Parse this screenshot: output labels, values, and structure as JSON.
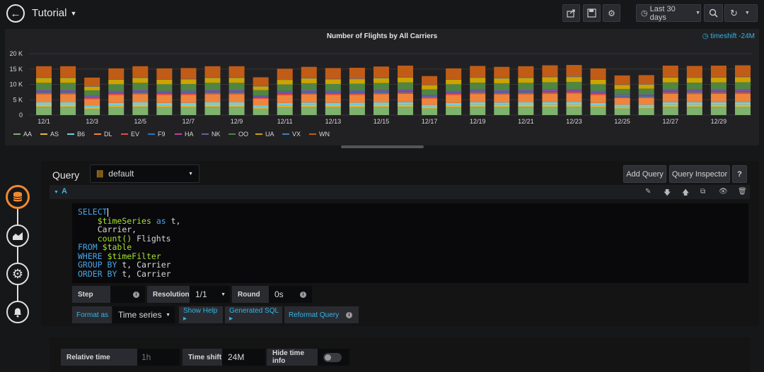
{
  "header": {
    "title": "Tutorial",
    "time_range": "Last 30 days",
    "icons": [
      "back-arrow-icon",
      "share-icon",
      "save-icon",
      "gear-icon",
      "clock-icon",
      "zoom-out-icon",
      "refresh-icon"
    ]
  },
  "panel": {
    "title": "Number of Flights by All Carriers",
    "timeshift_label": "timeshift -24M"
  },
  "chart_data": {
    "type": "bar",
    "stacked": true,
    "y_ticks": [
      "20 K",
      "15 K",
      "10 K",
      "5 K",
      "0"
    ],
    "ylim": [
      0,
      20000
    ],
    "x_tick_labels": [
      "12/1",
      "12/3",
      "12/5",
      "12/7",
      "12/9",
      "12/11",
      "12/13",
      "12/15",
      "12/17",
      "12/19",
      "12/21",
      "12/23",
      "12/25",
      "12/27",
      "12/29"
    ],
    "categories": [
      "12/1",
      "12/2",
      "12/3",
      "12/4",
      "12/5",
      "12/6",
      "12/7",
      "12/8",
      "12/9",
      "12/10",
      "12/11",
      "12/12",
      "12/13",
      "12/14",
      "12/15",
      "12/16",
      "12/17",
      "12/18",
      "12/19",
      "12/20",
      "12/21",
      "12/22",
      "12/23",
      "12/24",
      "12/25",
      "12/26",
      "12/27",
      "12/28",
      "12/29",
      "12/30"
    ],
    "totals": [
      15900,
      15900,
      12200,
      15200,
      15900,
      15200,
      15300,
      15900,
      15900,
      12300,
      15100,
      15700,
      15300,
      15400,
      15800,
      16100,
      12700,
      15200,
      16000,
      15700,
      15900,
      16200,
      16300,
      15200,
      12900,
      13000,
      16100,
      16000,
      16100,
      16200
    ],
    "carriers": [
      {
        "name": "AA",
        "color": "#7eb26d",
        "share": 0.17
      },
      {
        "name": "AS",
        "color": "#eab839",
        "share": 0.04
      },
      {
        "name": "B6",
        "color": "#6ed0e0",
        "share": 0.05
      },
      {
        "name": "DL",
        "color": "#ef843c",
        "share": 0.17
      },
      {
        "name": "EV",
        "color": "#e24d42",
        "share": 0.03
      },
      {
        "name": "F9",
        "color": "#1f78c1",
        "share": 0.02
      },
      {
        "name": "HA",
        "color": "#ba43a9",
        "share": 0.01
      },
      {
        "name": "NK",
        "color": "#705da0",
        "share": 0.03
      },
      {
        "name": "OO",
        "color": "#508642",
        "share": 0.14
      },
      {
        "name": "UA",
        "color": "#cca300",
        "share": 0.1
      },
      {
        "name": "VX",
        "color": "#447ebc",
        "share": 0.01
      },
      {
        "name": "WN",
        "color": "#c15c17",
        "share": 0.23
      }
    ]
  },
  "query": {
    "title": "Query",
    "datasource": "default",
    "add_query_label": "Add Query",
    "inspector_label": "Query Inspector",
    "help_label": "?",
    "ref_id": "A",
    "sql": {
      "l1_kw": "SELECT",
      "l2_macro": "$timeSeries",
      "l2_kw": "as",
      "l2_rest": "t,",
      "l3": "Carrier,",
      "l4_fn": "count()",
      "l4_rest": "Flights",
      "l5_kw": "FROM",
      "l5_rest": "$table",
      "l6_kw": "WHERE",
      "l6_macro": "$timeFilter",
      "l7_kw": "GROUP BY",
      "l7_rest": "t, Carrier",
      "l8_kw": "ORDER BY",
      "l8_rest": "t, Carrier"
    },
    "step_label": "Step",
    "step_value": "",
    "resolution_label": "Resolution",
    "resolution_value": "1/1",
    "round_label": "Round",
    "round_value": "0s",
    "format_as_label": "Format as",
    "format_as_value": "Time series",
    "show_help_label": "Show Help ▸",
    "generated_sql_label": "Generated SQL ▸",
    "reformat_label": "Reformat Query"
  },
  "options": {
    "relative_time_label": "Relative time",
    "relative_time_placeholder": "1h",
    "time_shift_label": "Time shift",
    "time_shift_value": "24M",
    "hide_time_info_label": "Hide time info",
    "hide_time_info_on": false
  }
}
